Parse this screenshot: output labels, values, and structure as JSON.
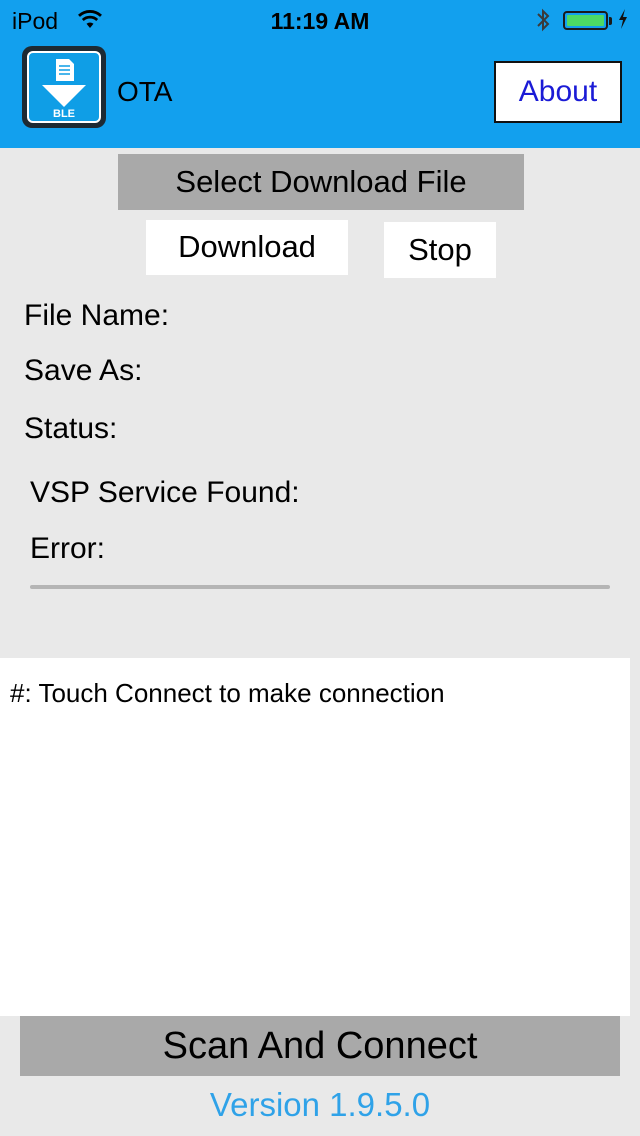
{
  "status_bar": {
    "carrier": "iPod",
    "time": "11:19 AM",
    "icons": [
      "wifi-icon",
      "bluetooth-icon",
      "battery-icon",
      "charging-bolt-icon"
    ],
    "battery_level": 1.0
  },
  "header": {
    "logo_text": "BLE",
    "title": "OTA",
    "about_label": "About"
  },
  "actions": {
    "select_file_label": "Select Download File",
    "download_label": "Download",
    "stop_label": "Stop"
  },
  "info": {
    "file_name_label": "File Name:",
    "save_as_label": "Save As:",
    "status_label": "Status:",
    "vsp_label": "VSP Service Found:",
    "error_label": "Error:"
  },
  "progress": {
    "value": 0
  },
  "log": {
    "text": "#: Touch Connect to make connection"
  },
  "footer": {
    "scan_label": "Scan And Connect",
    "version": "Version 1.9.5.0"
  },
  "colors": {
    "header_bg": "#12a0ee",
    "page_bg": "#e9e9e9",
    "gray_button": "#a9a9a9",
    "about_text": "#1b1bd6",
    "version_text": "#2fa2e8",
    "battery_fill": "#4cd964"
  }
}
